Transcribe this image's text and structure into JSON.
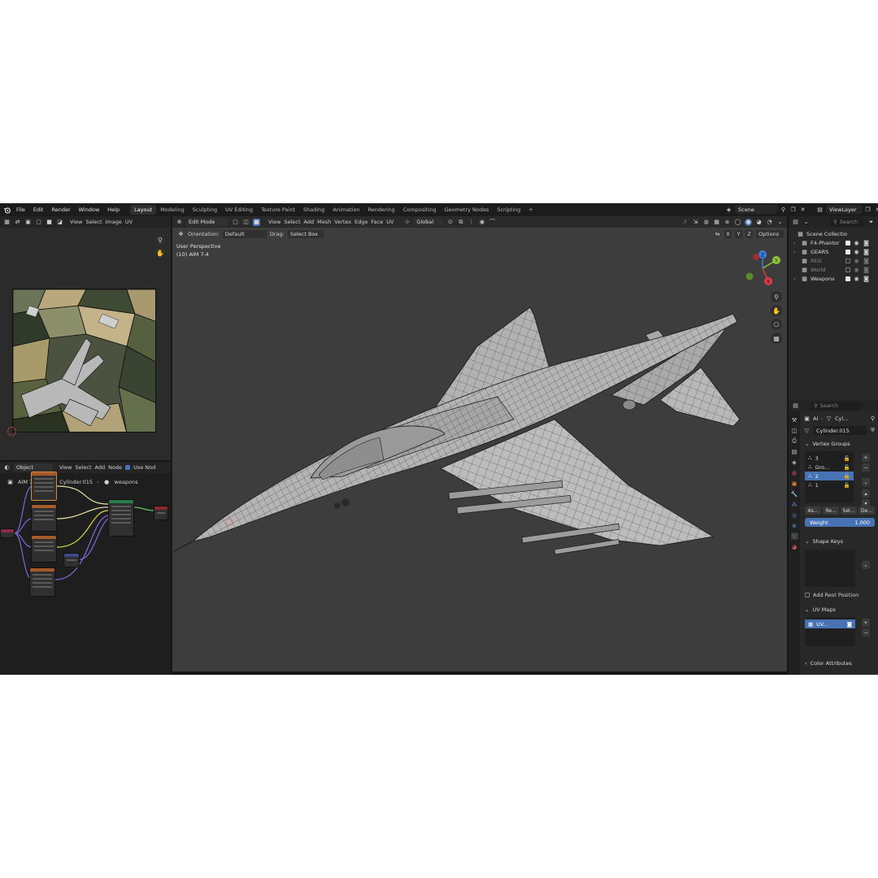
{
  "topbar": {
    "menus": [
      "File",
      "Edit",
      "Render",
      "Window",
      "Help"
    ],
    "workspaces": [
      "Layout",
      "Modeling",
      "Sculpting",
      "UV Editing",
      "Texture Paint",
      "Shading",
      "Animation",
      "Rendering",
      "Compositing",
      "Geometry Nodes",
      "Scripting"
    ],
    "active_workspace": "Layout",
    "add_tab": "+",
    "scene": "Scene",
    "view_layer": "ViewLayer"
  },
  "uv_editor": {
    "menus": [
      "View",
      "Select",
      "Image",
      "UV"
    ]
  },
  "node_editor": {
    "mode": "Object",
    "menus": [
      "View",
      "Select",
      "Add",
      "Node"
    ],
    "use_nodes": "Use Nod",
    "breadcrumb": [
      "AIM 7-4",
      "Cylinder.015",
      "weapons"
    ]
  },
  "viewport": {
    "mode": "Edit Mode",
    "menus": [
      "View",
      "Select",
      "Add",
      "Mesh",
      "Vertex",
      "Edge",
      "Face",
      "UV"
    ],
    "transform": "Global",
    "orientation_label": "Orientation:",
    "orientation_value": "Default",
    "drag_label": "Drag:",
    "drag_value": "Select Box",
    "axes": [
      "X",
      "Y",
      "Z"
    ],
    "options": "Options",
    "view_name": "User Perspective",
    "object_info": "(10) AIM 7-4",
    "gizmo": {
      "x": "X",
      "y": "Y",
      "z": "Z"
    }
  },
  "outliner": {
    "search_placeholder": "Search",
    "root": "Scene Collectio",
    "items": [
      {
        "label": "F4-Phantor",
        "checked": true
      },
      {
        "label": "GEARS",
        "checked": true
      },
      {
        "label": "REG",
        "checked": false
      },
      {
        "label": "World",
        "checked": false
      },
      {
        "label": "Weapons",
        "checked": true
      }
    ]
  },
  "properties": {
    "search_placeholder": "Search",
    "breadcrumb_a": "AI",
    "breadcrumb_b": "Cyl...",
    "mesh_name": "Cylinder.015",
    "vertex_groups": {
      "title": "Vertex Groups",
      "items": [
        "3",
        "Gro...",
        "2",
        "1"
      ],
      "selected_index": 2,
      "buttons": [
        "As...",
        "Re...",
        "Sel...",
        "De..."
      ],
      "weight_label": "Weight",
      "weight_value": "1.000"
    },
    "shape_keys": {
      "title": "Shape Keys"
    },
    "add_rest_position": "Add Rest Position",
    "uv_maps": {
      "title": "UV Maps",
      "item": "UV..."
    },
    "color_attributes": {
      "title": "Color Attributes"
    }
  },
  "colors": {
    "accent": "#4772b3",
    "mesh_surface": "#b4b4b4",
    "wire": "#1a1a1a",
    "gizmo_x": "#e0394c",
    "gizmo_y": "#8bc33a",
    "gizmo_z": "#3c7ddb"
  }
}
